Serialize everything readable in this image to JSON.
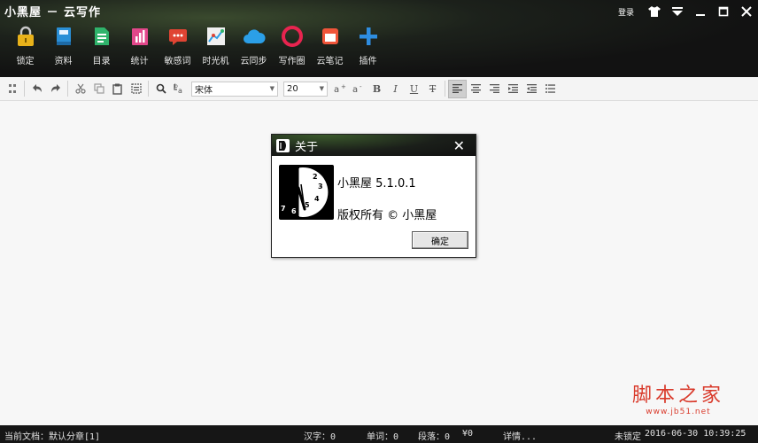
{
  "app": {
    "title": "小黑屋 － 云写作",
    "login_label": "登录"
  },
  "window_controls": {
    "skin_icon": "shirt-icon",
    "menu_icon": "menu-icon",
    "minimize_icon": "minimize-icon",
    "maximize_icon": "maximize-icon",
    "close_icon": "close-icon"
  },
  "main_toolbar": [
    {
      "label": "锁定",
      "icon": "lock-icon",
      "color": "#e8b21a"
    },
    {
      "label": "资料",
      "icon": "book-icon",
      "color": "#2a8fd6"
    },
    {
      "label": "目录",
      "icon": "document-list-icon",
      "color": "#2fb36b"
    },
    {
      "label": "统计",
      "icon": "bar-chart-icon",
      "color": "#e2478a"
    },
    {
      "label": "敏感词",
      "icon": "chat-bubble-icon",
      "color": "#e04433"
    },
    {
      "label": "时光机",
      "icon": "line-chart-icon",
      "color": "#f0f0f0"
    },
    {
      "label": "云同步",
      "icon": "cloud-icon",
      "color": "#2b9fe8"
    },
    {
      "label": "写作圈",
      "icon": "ring-icon",
      "color": "#e8244f"
    },
    {
      "label": "云笔记",
      "icon": "note-icon",
      "color": "#f0553a"
    },
    {
      "label": "插件",
      "icon": "plus-icon",
      "color": "#2e8de0"
    }
  ],
  "format_toolbar": {
    "font_name": "宋体",
    "font_size": "20"
  },
  "dialog": {
    "title": "关于",
    "version_line": "小黑屋 5.1.0.1",
    "copyright_line": "版权所有 © 小黑屋",
    "ok_label": "确定",
    "clock_numbers": [
      "2",
      "3",
      "4",
      "5",
      "6",
      "7"
    ]
  },
  "watermark": {
    "big": "脚本之家",
    "small": "www.jb51.net"
  },
  "status": {
    "current_doc": "当前文档：默认分章[1]",
    "chars": "汉字：0",
    "words": "单词：0",
    "paragraphs": "段落：0",
    "money": "¥0",
    "details": "详情...",
    "lock_state": "未锁定",
    "datetime": "2016-06-30 10:39:25"
  }
}
